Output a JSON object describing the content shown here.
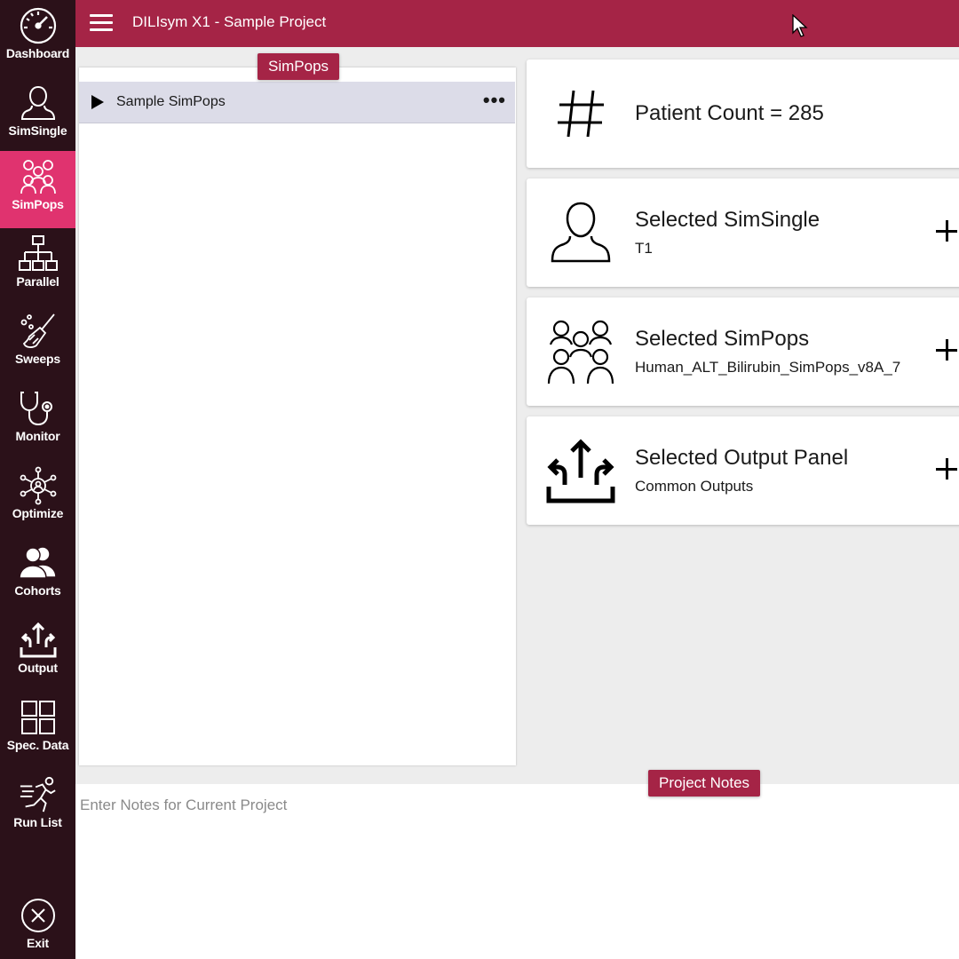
{
  "header": {
    "title": "DILIsym X1 - Sample Project",
    "menu_icon": "hamburger-menu-icon"
  },
  "sidebar": {
    "items": [
      {
        "label": "Dashboard",
        "icon": "speedometer-icon"
      },
      {
        "label": "SimSingle",
        "icon": "person-icon"
      },
      {
        "label": "SimPops",
        "icon": "group-icon",
        "active": true
      },
      {
        "label": "Parallel",
        "icon": "hierarchy-icon"
      },
      {
        "label": "Sweeps",
        "icon": "broom-icon"
      },
      {
        "label": "Monitor",
        "icon": "stethoscope-icon"
      },
      {
        "label": "Optimize",
        "icon": "network-icon"
      },
      {
        "label": "Cohorts",
        "icon": "cohort-icon"
      },
      {
        "label": "Output",
        "icon": "output-arrows-icon"
      },
      {
        "label": "Spec. Data",
        "icon": "grid-icon"
      },
      {
        "label": "Run List",
        "icon": "runner-icon"
      }
    ],
    "exit": {
      "label": "Exit",
      "icon": "close-circle-icon"
    }
  },
  "simpops_panel": {
    "title": "SimPops",
    "items": [
      {
        "label": "Sample SimPops",
        "more": "•••"
      }
    ]
  },
  "cards": {
    "patient_count": {
      "title": "Patient Count = 285",
      "icon": "hash-icon"
    },
    "simsingle": {
      "title": "Selected SimSingle",
      "subtitle": "T1",
      "icon": "person-icon"
    },
    "simpops": {
      "title": "Selected SimPops",
      "subtitle": "Human_ALT_Bilirubin_SimPops_v8A_7",
      "icon": "group-icon"
    },
    "output_panel": {
      "title": "Selected Output Panel",
      "subtitle": "Common Outputs",
      "icon": "output-arrows-icon"
    }
  },
  "notes": {
    "title": "Project Notes",
    "placeholder": "Enter Notes for Current Project",
    "value": ""
  },
  "colors": {
    "header": "#a52446",
    "sidebar": "#2b1119",
    "active": "#e0336f",
    "pill": "#a52446"
  }
}
